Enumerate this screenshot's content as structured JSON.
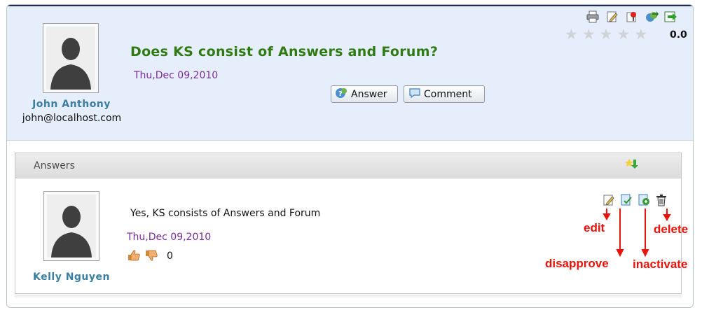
{
  "question": {
    "title": "Does KS consist of Answers and Forum?",
    "date": "Thu,Dec 09,2010",
    "author_name": "John Anthony",
    "author_email": "john@localhost.com",
    "rating_value": "0.0",
    "stars_filled": 0,
    "stars_total": 5,
    "buttons": {
      "answer": "Answer",
      "comment": "Comment"
    },
    "toolbar_icons": [
      "print-icon",
      "edit-icon",
      "watch-icon",
      "move-icon",
      "export-icon"
    ]
  },
  "answers": {
    "title": "Answers",
    "sort_icon": "sort-icon",
    "items": [
      {
        "author_name": "Kelly Nguyen",
        "text": "Yes, KS consists of Answers and Forum",
        "date": "Thu,Dec 09,2010",
        "vote_count": "0",
        "tool_icons": [
          "edit-icon",
          "disapprove-icon",
          "inactivate-icon",
          "delete-icon"
        ]
      }
    ]
  },
  "annotations": {
    "edit": "edit",
    "disapprove": "disapprove",
    "inactivate": "inactivate",
    "delete": "delete"
  },
  "colors": {
    "question_bg": "#e5eefa",
    "title": "#2f7a12",
    "date": "#7b2b9c",
    "author": "#3a7ea3",
    "annotation": "#e8140c"
  }
}
